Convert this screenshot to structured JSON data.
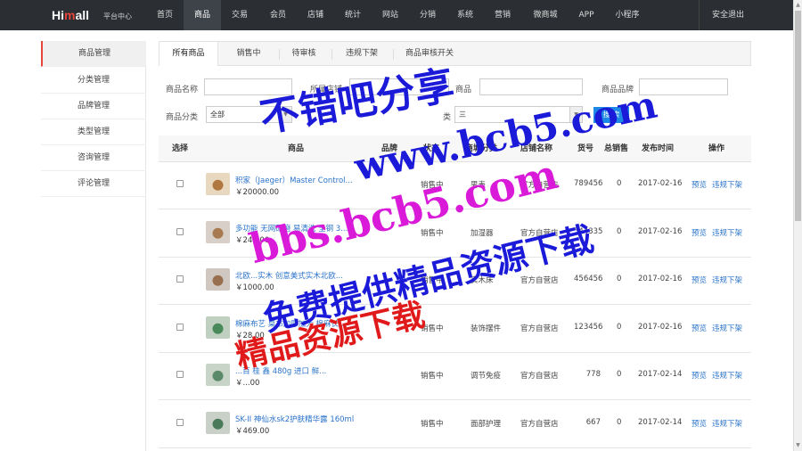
{
  "brand": {
    "logo_hi": "Hi",
    "logo_m": "m",
    "logo_rest": "all",
    "sub": "平台中心"
  },
  "nav": {
    "items": [
      "首页",
      "商品",
      "交易",
      "会员",
      "店铺",
      "统计",
      "网站",
      "分销",
      "系统",
      "营销",
      "微商城",
      "APP",
      "小程序"
    ],
    "active": "商品",
    "logout": "安全退出"
  },
  "sidebar": {
    "items": [
      "商品管理",
      "分类管理",
      "品牌管理",
      "类型管理",
      "咨询管理",
      "评论管理"
    ],
    "active": "商品管理"
  },
  "tabs": [
    "所有商品",
    "销售中",
    "待审核",
    "违规下架",
    "商品审核开关"
  ],
  "filters": {
    "name_label": "商品名称",
    "shop_label": "所属店铺",
    "product_label": "商品",
    "brand_label": "商品品牌",
    "category_label": "商品分类",
    "category_value": "全部",
    "type_label": "类",
    "type_value": "三",
    "search_button": "搜 索"
  },
  "table": {
    "headers": [
      "选择",
      "商品",
      "品牌",
      "状态",
      "商城分类",
      "店铺名称",
      "货号",
      "总销售",
      "发布时间",
      "操作"
    ],
    "rows": [
      {
        "name": "积家（Jaeger）Master Control...",
        "price": "￥20000.00",
        "status": "销售中",
        "category": "男表",
        "shop": "官方自营店",
        "sku": "789456",
        "sales": "0",
        "date": "2017-02-16"
      },
      {
        "name": "多功能 无网研磨 易清洗 全钢 3...",
        "price": "￥249.00",
        "status": "销售中",
        "category": "加湿器",
        "shop": "官方自营店",
        "sku": "544335",
        "sales": "0",
        "date": "2017-02-16"
      },
      {
        "name": "北欧...实木 创意美式实木北欧...",
        "price": "￥1000.00",
        "status": "销售中",
        "category": "实木床",
        "shop": "官方自营店",
        "sku": "456456",
        "sales": "0",
        "date": "2017-02-16"
      },
      {
        "name": "棉麻布艺 桌布加厚加大 棉麻长...",
        "price": "￥28.00",
        "status": "销售中",
        "category": "装饰摆件",
        "shop": "官方自营店",
        "sku": "123456",
        "sales": "0",
        "date": "2017-02-16"
      },
      {
        "name": "...百 桂 鑫 480g 进口 鲜...",
        "price": "￥...00",
        "status": "销售中",
        "category": "调节免疫",
        "shop": "官方自营店",
        "sku": "778",
        "sales": "0",
        "date": "2017-02-14"
      },
      {
        "name": "SK-II 神仙水sk2护肤精华露 160ml",
        "price": "￥469.00",
        "status": "销售中",
        "category": "面部护理",
        "shop": "官方自营店",
        "sku": "667",
        "sales": "0",
        "date": "2017-02-14"
      }
    ],
    "action_preview": "预览",
    "action_violation": "违规下架"
  },
  "watermark": {
    "line1": "不错吧分享",
    "line2": "www.bcb5.com",
    "line3": "bbs.bcb5.com",
    "line4": "免费提供精品资源下载",
    "line5": "精品资源下载"
  },
  "colors": {
    "topbar": "#2b2e33",
    "accent": "#e8463b",
    "link": "#2a73c9",
    "button": "#1e88e5"
  }
}
